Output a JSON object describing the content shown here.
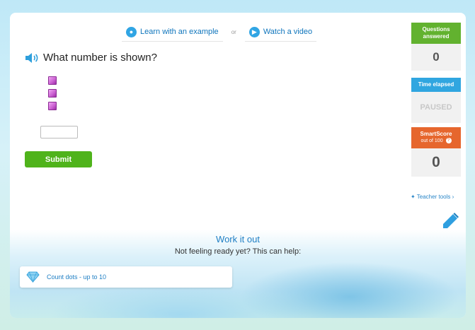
{
  "help": {
    "learn_label": "Learn with an example",
    "or_label": "or",
    "video_label": "Watch a video"
  },
  "question": {
    "text": "What number is shown?",
    "cube_count": 3,
    "answer_value": ""
  },
  "submit_label": "Submit",
  "sidebar": {
    "questions_answered_label": "Questions answered",
    "questions_answered_value": "0",
    "time_elapsed_label": "Time elapsed",
    "time_elapsed_value": "PAUSED",
    "smartscore_label": "SmartScore",
    "smartscore_sub": "out of 100",
    "smartscore_value": "0"
  },
  "teacher_tools_label": "Teacher tools ›",
  "workout": {
    "title": "Work it out",
    "subtitle": "Not feeling ready yet? This can help:",
    "skill_link": "Count dots - up to 10"
  },
  "colors": {
    "green": "#62b22f",
    "blue": "#30a6e0",
    "orange": "#e6662d",
    "submit": "#4fb31b",
    "cube": "#c95fd0"
  },
  "icons": [
    "lightbulb-icon",
    "play-icon",
    "speaker-icon",
    "question-icon",
    "sparkle-icon",
    "pencil-icon",
    "diamond-icon"
  ]
}
